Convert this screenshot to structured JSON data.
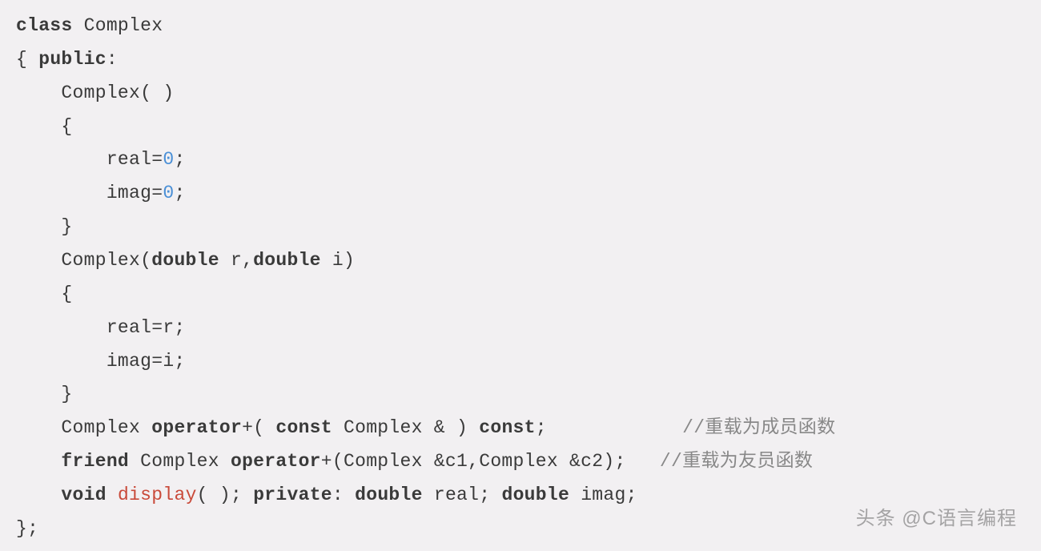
{
  "code": {
    "l1_class": "class",
    "l1_name": " Complex",
    "l2_open": "{ ",
    "l2_public": "public",
    "l2_colon": ":",
    "l3": "    Complex( )",
    "l4": "    {",
    "l5_indent": "        real=",
    "l5_zero": "0",
    "l5_semi": ";",
    "l6_indent": "        imag=",
    "l6_zero": "0",
    "l6_semi": ";",
    "l7": "    }",
    "l8_indent": "    Complex(",
    "l8_double1": "double",
    "l8_r": " r,",
    "l8_double2": "double",
    "l8_i": " i)",
    "l9": "    {",
    "l10": "        real=r;",
    "l11": "        imag=i;",
    "l12": "    }",
    "l13_indent": "    Complex ",
    "l13_operator": "operator",
    "l13_plus": "+( ",
    "l13_const1": "const",
    "l13_mid": " Complex & ) ",
    "l13_const2": "const",
    "l13_semi": ";",
    "l13_pad": "            ",
    "l13_comment": "//重载为成员函数",
    "l14_indent": "    ",
    "l14_friend": "friend",
    "l14_mid1": " Complex ",
    "l14_operator": "operator",
    "l14_rest": "+(Complex &c1,Complex &c2);",
    "l14_pad": "   ",
    "l14_comment": "//重载为友员函数",
    "l15_indent": "    ",
    "l15_void": "void",
    "l15_sp1": " ",
    "l15_display": "display",
    "l15_mid1": "( ); ",
    "l15_private": "private",
    "l15_mid2": ": ",
    "l15_double1": "double",
    "l15_mid3": " real; ",
    "l15_double2": "double",
    "l15_mid4": " imag;",
    "l16": "};"
  },
  "watermark": "头条 @C语言编程"
}
